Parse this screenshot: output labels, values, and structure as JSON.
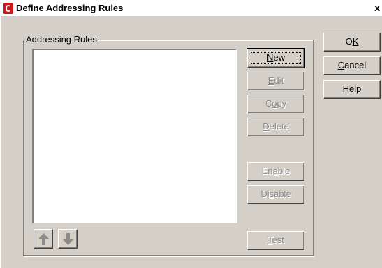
{
  "window": {
    "title": "Define Addressing Rules",
    "close_glyph": "x"
  },
  "group": {
    "label": "Addressing Rules"
  },
  "list": {
    "items": []
  },
  "rule_buttons": {
    "new": {
      "pre": "",
      "ul": "N",
      "post": "ew"
    },
    "edit": {
      "pre": "",
      "ul": "E",
      "post": "dit"
    },
    "copy": {
      "pre": "C",
      "ul": "o",
      "post": "py"
    },
    "delete": {
      "pre": "",
      "ul": "D",
      "post": "elete"
    },
    "enable": {
      "pre": "En",
      "ul": "a",
      "post": "ble"
    },
    "disable": {
      "pre": "Di",
      "ul": "s",
      "post": "able"
    },
    "test": {
      "pre": "",
      "ul": "T",
      "post": "est"
    }
  },
  "dialog_buttons": {
    "ok": {
      "pre": "O",
      "ul": "K",
      "post": ""
    },
    "cancel": {
      "pre": "",
      "ul": "C",
      "post": "ancel"
    },
    "help": {
      "pre": "",
      "ul": "H",
      "post": "elp"
    }
  },
  "icons": {
    "move_up": "arrow-up-icon",
    "move_down": "arrow-down-icon",
    "app": "novell-app-icon"
  },
  "colors": {
    "dialog_bg": "#d4d0c8",
    "disabled_text": "#8a8a8a",
    "app_icon_red": "#cc1a1a"
  }
}
